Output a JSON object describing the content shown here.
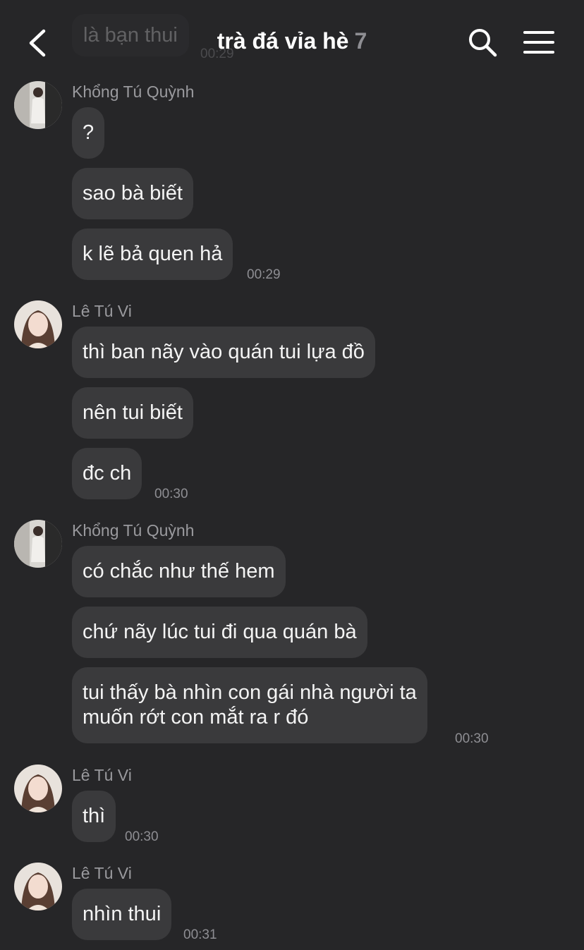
{
  "header": {
    "title": "trà đá vỉa hè",
    "member_count": "7",
    "back_icon": "chevron-left-icon",
    "search_icon": "search-icon",
    "menu_icon": "menu-icon"
  },
  "previous": {
    "text": "là bạn thui"
  },
  "messages": [
    {
      "sender": "Khổng Tú Quỳnh",
      "bubbles": [
        "?",
        "sao bà biết",
        "k lẽ bả quen hả"
      ],
      "time": "00:29"
    },
    {
      "sender": "Lê Tú Vi",
      "bubbles": [
        "thì ban nãy vào quán tui lựa đồ",
        "nên tui biết",
        "đc ch"
      ],
      "time": "00:30"
    },
    {
      "sender": "Khổng Tú Quỳnh",
      "bubbles": [
        "có chắc như thế hem",
        "chứ nãy lúc tui đi qua quán bà",
        "tui thấy bà nhìn con gái nhà người ta",
        "muốn rớt con mắt ra r đó"
      ],
      "time": "00:30"
    },
    {
      "sender": "Lê Tú Vi",
      "bubbles": [
        "thì"
      ],
      "time": "00:30"
    },
    {
      "sender": "Lê Tú Vi",
      "bubbles": [
        "nhìn thui"
      ],
      "time": "00:31"
    }
  ],
  "colors": {
    "background": "#262628",
    "bubble": "#3a3a3c",
    "secondary_text": "#8e8e93"
  }
}
